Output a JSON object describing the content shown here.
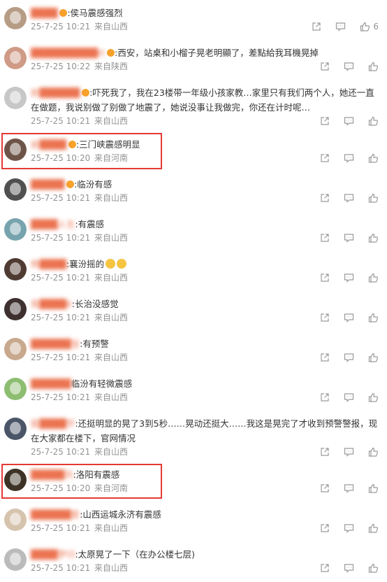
{
  "comments": [
    {
      "name": "████",
      "badge": true,
      "text": ":侯马震感强烈",
      "time": "25-7-25 10:21",
      "source": "来自山西",
      "likes": "6",
      "avatar_color": "#b79c85",
      "highlight": false
    },
    {
      "name": "██████████rt",
      "badge": true,
      "text": ":西安，站桌和小榴子晃老明顯了，差點給我耳機晃掉",
      "time": "25-7-25 10:22",
      "source": "来自陕西",
      "likes": "",
      "avatar_color": "#cf9a86",
      "highlight": false
    },
    {
      "name": "前██████",
      "badge": true,
      "text": ":吓死我了，我在23楼带一年级小孩家教…家里只有我们两个人，她还一直在做题，我说别做了别做了地震了，她说没事让我做完，你还在计时呢…",
      "time": "25-7-25 10:21",
      "source": "来自山西",
      "likes": "",
      "avatar_color": "#c7c7c7",
      "highlight": false
    },
    {
      "name": "前████",
      "badge": true,
      "text": ":三门峡震感明显",
      "time": "25-7-25 10:20",
      "source": "来自河南",
      "likes": "",
      "avatar_color": "#6e5448",
      "highlight": true
    },
    {
      "name": "█████",
      "badge": true,
      "text": ":临汾有感",
      "time": "25-7-25 10:21",
      "source": "来自山西",
      "likes": "",
      "avatar_color": "#505050",
      "highlight": false
    },
    {
      "name": "████人生",
      "badge": false,
      "text": ":有震感",
      "time": "25-7-25 10:21",
      "source": "来自山西",
      "likes": "",
      "avatar_color": "#77a3ae",
      "highlight": false
    },
    {
      "name": "杨████",
      "badge": false,
      "text": ":襄汾摇的",
      "emoji": true,
      "time": "25-7-25 10:21",
      "source": "来自山西",
      "likes": "",
      "avatar_color": "#4f3b32",
      "highlight": false
    },
    {
      "name": "我████6",
      "badge": false,
      "text": ":长治没感觉",
      "time": "25-7-25 10:21",
      "source": "来自山西",
      "likes": "",
      "avatar_color": "#3f3030",
      "highlight": false
    },
    {
      "name": "██████宝",
      "badge": false,
      "text": ":有预警",
      "time": "25-7-25 10:21",
      "source": "来自山西",
      "likes": "",
      "avatar_color": "#c8a98e",
      "highlight": false
    },
    {
      "name": "██████",
      "badge": false,
      "text": "临汾有轻微震感",
      "time": "25-7-25 10:21",
      "source": "来自山西",
      "likes": "",
      "avatar_color": "#8dbd70",
      "highlight": false
    },
    {
      "name": "狐████宇",
      "badge": false,
      "text": ":还挺明显的晃了3到5秒……晃动还挺大……我这是晃完了才收到预警警报，现在大家都在楼下，官网情况",
      "time": "25-7-25 10:21",
      "source": "来自山西",
      "likes": "",
      "avatar_color": "#4a5668",
      "highlight": false
    },
    {
      "name": "█████风",
      "badge": false,
      "text": ":洛阳有震感",
      "time": "25-7-25 10:20",
      "source": "来自河南",
      "likes": "",
      "avatar_color": "#3d3326",
      "highlight": true
    },
    {
      "name": "██████爱",
      "badge": false,
      "text": ":山西运城永济有震感",
      "time": "25-7-25 10:21",
      "source": "来自山西",
      "likes": "",
      "avatar_color": "#d6c3ad",
      "highlight": false
    },
    {
      "name": "████梦归",
      "badge": false,
      "text": ":太原晃了一下（在办公楼七层)",
      "time": "25-7-25 10:21",
      "source": "来自山西",
      "likes": "",
      "avatar_color": "#bbbbbb",
      "highlight": false
    }
  ],
  "icons": {
    "share": "share-icon",
    "comment": "comment-icon",
    "like": "like-icon"
  },
  "colors": {
    "name": "#eb7350",
    "meta": "#939393",
    "highlight": "#e53935"
  }
}
